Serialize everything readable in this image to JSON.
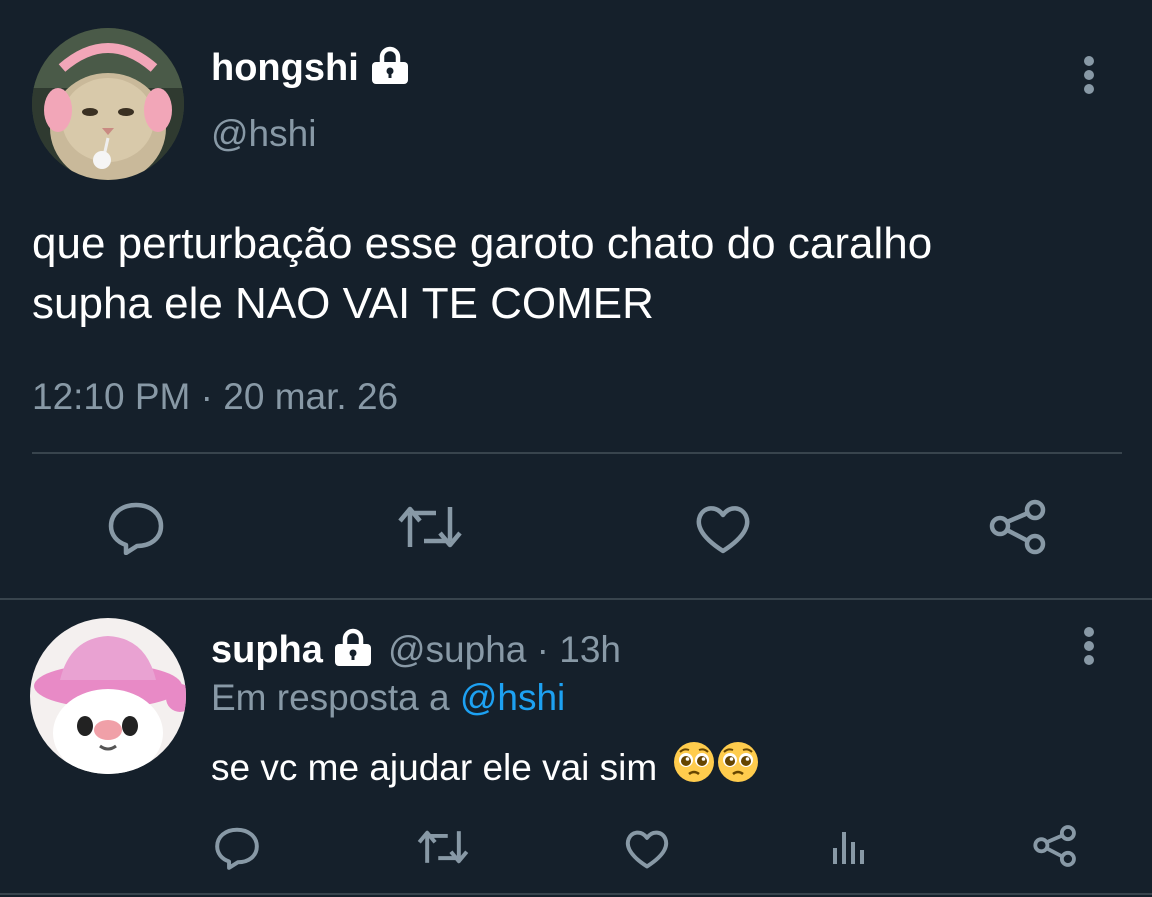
{
  "colors": {
    "background": "#15202b",
    "text": "#ffffff",
    "muted": "#8899a6",
    "divider": "#38444d",
    "mention": "#1da1f2"
  },
  "main_tweet": {
    "display_name": "hongshi",
    "handle": "@hshi",
    "text_line1": "que perturbação esse garoto chato do caralho",
    "text_line2": "supha ele NAO VAI TE COMER",
    "time": "12:10 PM",
    "separator": "·",
    "date": "20 mar. 26",
    "lock_icon": "lock-icon",
    "more_icon": "more-vertical-icon",
    "actions": [
      "reply-icon",
      "retweet-icon",
      "like-icon",
      "share-icon"
    ]
  },
  "reply_tweet": {
    "display_name": "supha",
    "handle": "@supha",
    "separator": "·",
    "age": "13h",
    "replying_prefix": "Em resposta a",
    "replying_to": "@hshi",
    "text": "se vc me ajudar ele vai sim",
    "emojis": [
      "pleading-face-emoji",
      "pleading-face-emoji"
    ],
    "actions": [
      "reply-icon",
      "retweet-icon",
      "like-icon",
      "analytics-icon",
      "share-icon"
    ]
  }
}
